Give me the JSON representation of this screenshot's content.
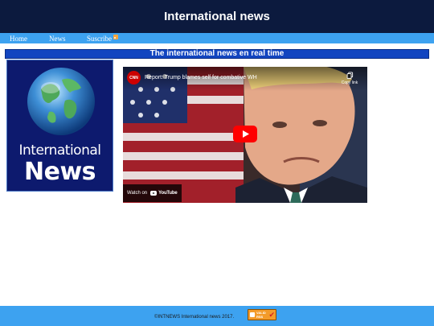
{
  "header": {
    "title": "International news"
  },
  "nav": {
    "items": [
      {
        "label": "Home"
      },
      {
        "label": "News"
      },
      {
        "label": "Suscribe"
      }
    ],
    "rss_icon": "rss-icon"
  },
  "section": {
    "title": "The international news en real time"
  },
  "logo": {
    "line1": "International",
    "line2": "News"
  },
  "video": {
    "channel": "CNN",
    "title": "Report: Trump blames self for combative WH",
    "copy_label": "Copy link",
    "watch_label": "Watch on",
    "platform": "YouTube",
    "play_icon": "play-icon"
  },
  "footer": {
    "text": "©INTNEWS International news 2017.",
    "badge_line1": "VALID",
    "badge_line2": "RSS"
  },
  "colors": {
    "header_bg": "#0c1a3e",
    "nav_bg": "#3da2f0",
    "banner_bg": "#1245c0",
    "footer_bg": "#3da2f0",
    "play_red": "#ff0000"
  }
}
